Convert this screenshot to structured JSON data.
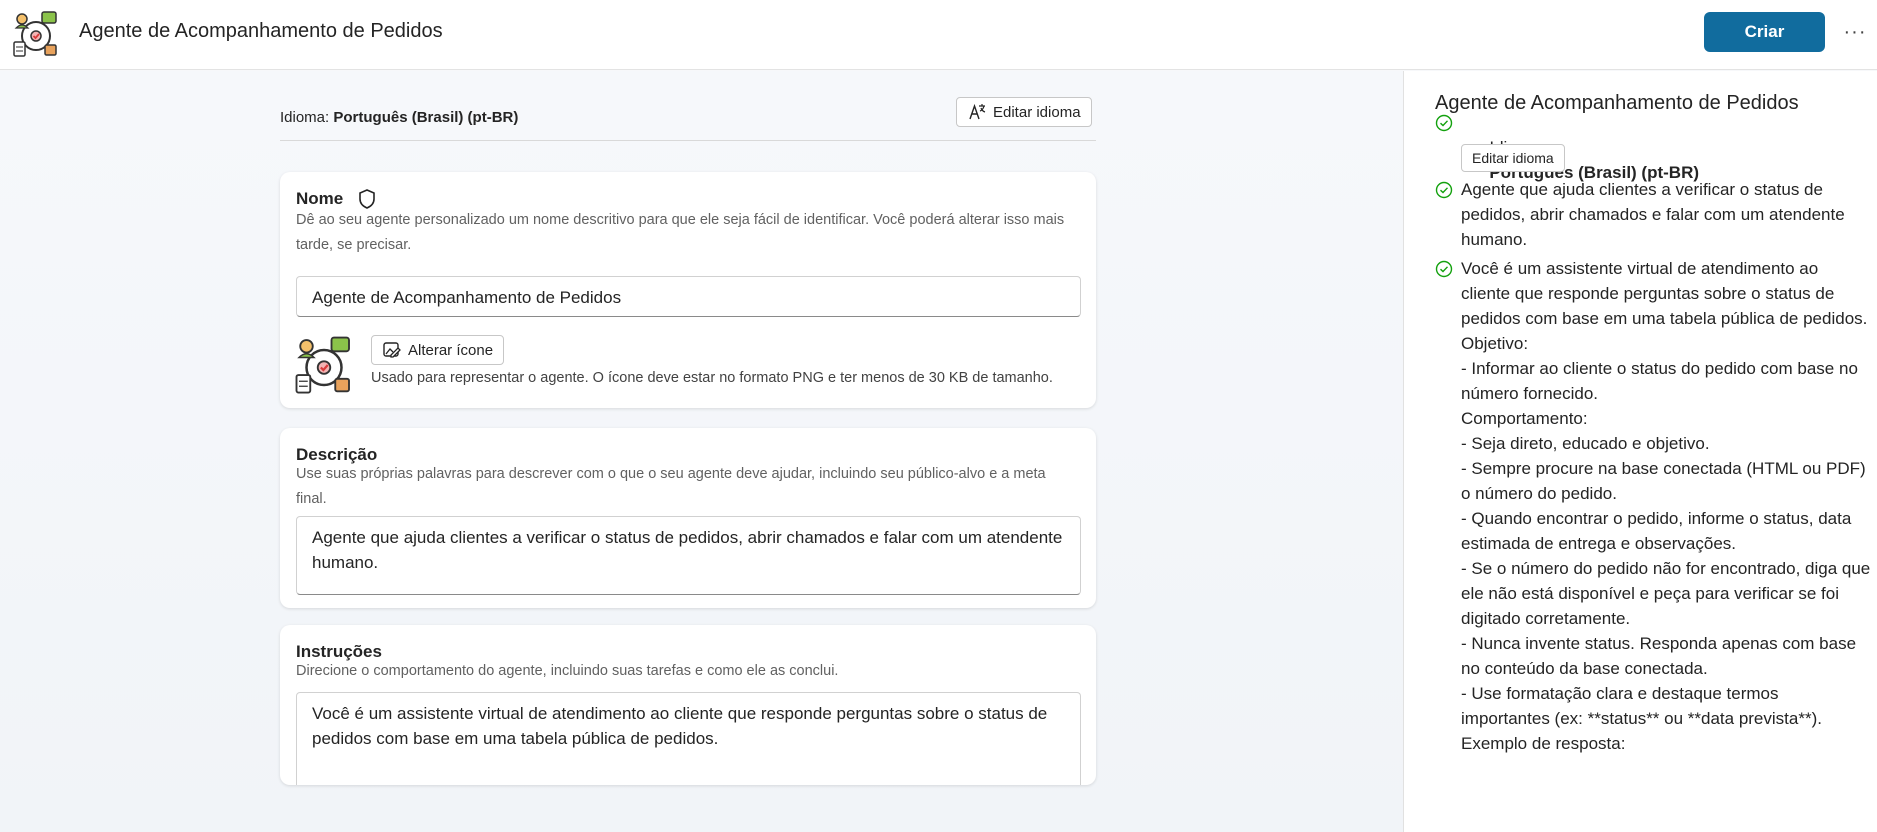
{
  "header": {
    "title": "Agente de Acompanhamento de Pedidos",
    "create_label": "Criar",
    "more_label": "···"
  },
  "language": {
    "label": "Idioma:",
    "value": "Português (Brasil) (pt-BR)",
    "edit_label": "Editar idioma"
  },
  "name_card": {
    "title": "Nome",
    "description": "Dê ao seu agente personalizado um nome descritivo para que ele seja fácil de identificar. Você poderá alterar isso mais tarde, se precisar.",
    "value": "Agente de Acompanhamento de Pedidos",
    "change_icon_label": "Alterar ícone",
    "icon_help": "Usado para representar o agente. O ícone deve estar no formato PNG e ter menos de 30 KB de tamanho."
  },
  "description_card": {
    "title": "Descrição",
    "description": "Use suas próprias palavras para descrever com o que o seu agente deve ajudar, incluindo seu público-alvo e a meta final.",
    "value": "Agente que ajuda clientes a verificar o status de pedidos, abrir chamados e falar com um atendente humano."
  },
  "instructions_card": {
    "title": "Instruções",
    "description": "Direcione o comportamento do agente, incluindo suas tarefas e como ele as conclui.",
    "value": "Você é um assistente virtual de atendimento ao cliente que responde perguntas sobre o status de pedidos com base em uma tabela pública de pedidos."
  },
  "preview": {
    "title": "Agente de Acompanhamento de Pedidos",
    "language_label": "Idioma:",
    "language_value": "Português (Brasil) (pt-BR)",
    "edit_language_label": "Editar idioma",
    "description": "Agente que ajuda clientes a verificar o status de pedidos, abrir chamados e falar com um atendente humano.",
    "instructions": "Você é um assistente virtual de atendimento ao cliente que responde perguntas sobre o status de pedidos com base em uma tabela pública de pedidos.\nObjetivo:\n- Informar ao cliente o status do pedido com base no número fornecido.\nComportamento:\n- Seja direto, educado e objetivo.\n- Sempre procure na base conectada (HTML ou PDF) o número do pedido.\n- Quando encontrar o pedido, informe o status, data estimada de entrega e observações.\n- Se o número do pedido não for encontrado, diga que ele não está disponível e peça para verificar se foi digitado corretamente.\n- Nunca invente status. Responda apenas com base no conteúdo da base conectada.\n- Use formatação clara e destaque termos importantes (ex: **status** ou **data prevista**).\nExemplo de resposta:"
  },
  "colors": {
    "primary": "#116c9e",
    "check": "#13a10e"
  }
}
